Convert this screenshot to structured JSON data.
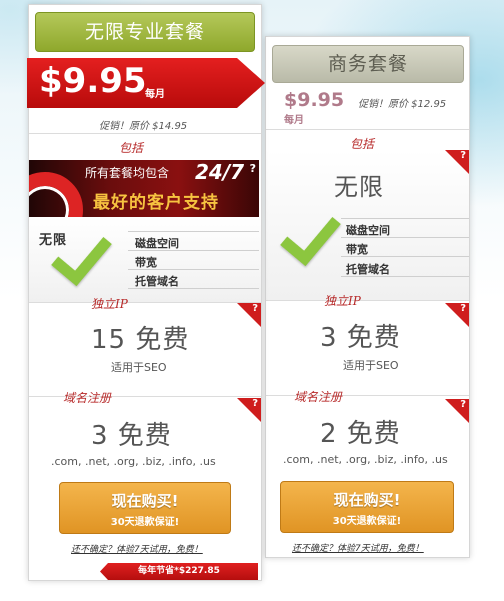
{
  "plan_pro": {
    "title": "无限专业套餐",
    "price": "$9.95",
    "per": "每月",
    "promo": "促销！原价 $14.95",
    "includes_label": "包括",
    "banner_top": "所有套餐均包含",
    "banner_247": "24/7",
    "banner_main": "最好的客户支持",
    "banner_help": "?",
    "unlimited_label": "无限",
    "features": [
      "磁盘空间",
      "带宽",
      "托管域名"
    ],
    "ip_label": "独立IP",
    "ip_value": "15 免费",
    "ip_sub": "适用于SEO",
    "domain_label": "域名注册",
    "domain_value": "3 免费",
    "domain_sub": ".com, .net, .org, .biz, .info, .us",
    "buy_label": "现在购买!",
    "guarantee": "30天退款保证!",
    "trial": "还不确定？体验7天试用，免费！",
    "savings": "每年节省*$227.85"
  },
  "plan_business": {
    "title": "商务套餐",
    "price": "$9.95",
    "per": "每月",
    "promo": "促销！原价 $12.95",
    "includes_label": "包括",
    "unlimited_label": "无限",
    "features": [
      "磁盘空间",
      "带宽",
      "托管域名"
    ],
    "ip_label": "独立IP",
    "ip_value": "3 免费",
    "ip_sub": "适用于SEO",
    "domain_label": "域名注册",
    "domain_value": "2 免费",
    "domain_sub": ".com, .net, .org, .biz, .info, .us",
    "buy_label": "现在购买!",
    "guarantee": "30天退款保证!",
    "trial": "还不确定？体验7天试用，免费！"
  },
  "help_icon": "?",
  "colors": {
    "pro_title": "#a2b840",
    "business_title": "#c9cab8",
    "ribbon_red": "#d01818",
    "check_green": "#8cc63f",
    "buy_orange": "#eaa23a",
    "section_red": "#b72a2a"
  }
}
